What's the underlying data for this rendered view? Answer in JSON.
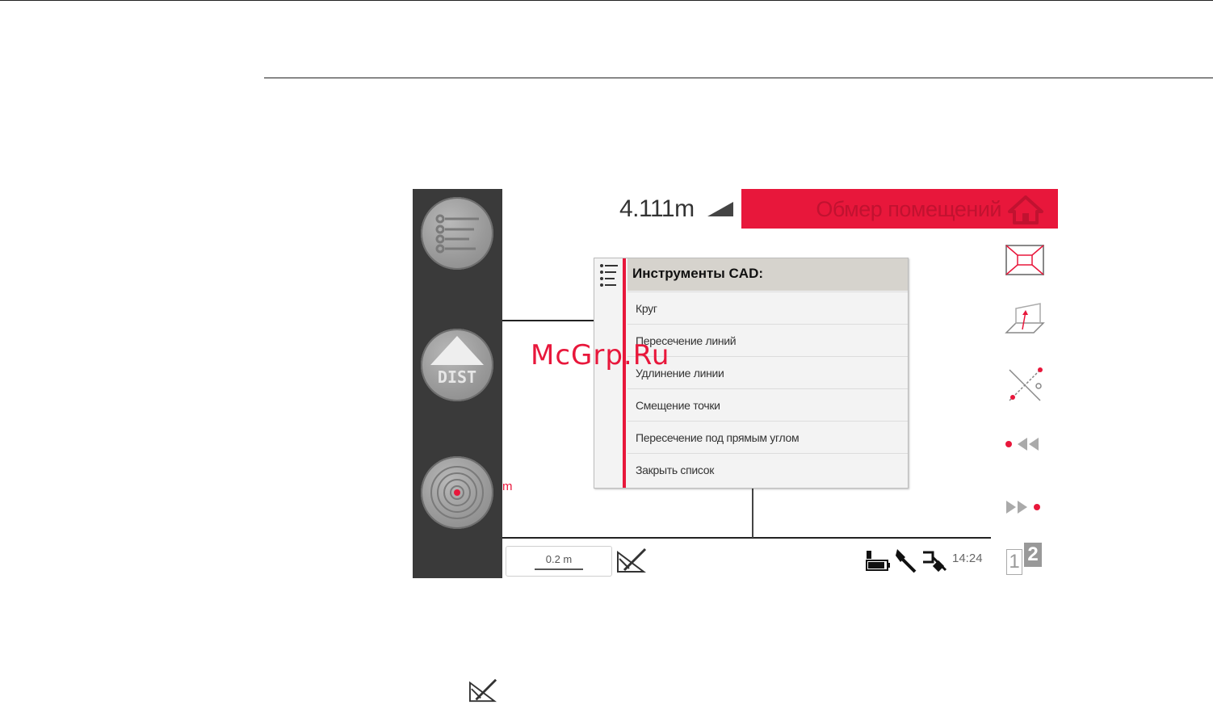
{
  "measurement": {
    "value": "4.111m"
  },
  "titlebar": {
    "title": "Обмер помещений"
  },
  "left_buttons": {
    "dist_label": "DIST"
  },
  "canvas": {
    "pink_unit": "m"
  },
  "menu": {
    "header": "Инструменты CAD:",
    "items": [
      "Круг",
      "Пересечение линий",
      "Удлинение линии",
      "Смещение точки",
      "Пересечение под прямым углом",
      "Закрыть список"
    ]
  },
  "statusbar": {
    "scale": "0.2 m",
    "time": "14:24"
  },
  "page_indicator": {
    "current": "1",
    "other": "2"
  },
  "watermark": "McGrp.Ru",
  "icons": {
    "list": "list-icon",
    "dist": "dist-arrow-icon",
    "target": "target-icon",
    "signal": "signal-strength-icon",
    "home": "home-icon",
    "floorplan": "floorplan-view-icon",
    "3d": "3d-view-icon",
    "cad": "cad-tools-icon",
    "prev": "previous-point-icon",
    "next": "next-point-icon",
    "draw": "draw-tool-icon",
    "battery": "battery-icon",
    "bluetooth": "connection-icon",
    "plug": "power-plug-icon"
  },
  "colors": {
    "accent": "#e8173b",
    "sidebar": "#3a3a3a",
    "menu_header": "#d6d3cd"
  }
}
